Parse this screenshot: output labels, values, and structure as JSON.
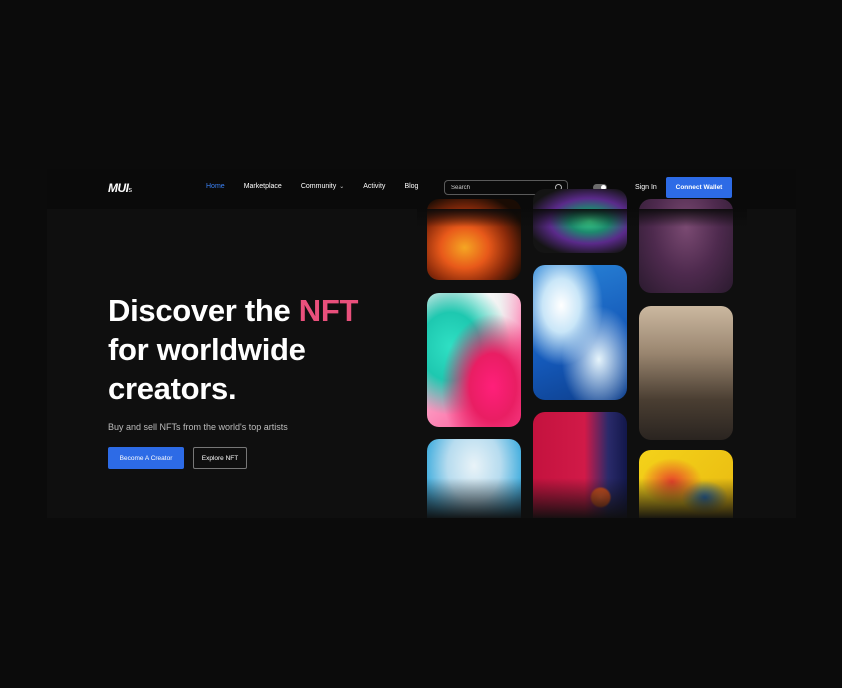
{
  "navbar": {
    "logo": "MUI",
    "logo_suffix": "s",
    "links": [
      {
        "label": "Home",
        "active": true
      },
      {
        "label": "Marketplace",
        "active": false
      },
      {
        "label": "Community",
        "active": false,
        "has_dropdown": true
      },
      {
        "label": "Activity",
        "active": false
      },
      {
        "label": "Blog",
        "active": false
      }
    ],
    "search_placeholder": "Search",
    "theme_toggle": "dark",
    "signin_label": "Sign In",
    "connect_label": "Connect Wallet"
  },
  "hero": {
    "title_part1": "Discover the ",
    "title_accent": "NFT",
    "title_line2": "for worldwide",
    "title_line3": "creators.",
    "subtitle": "Buy and sell NFTs from the world's top artists",
    "primary_button": "Become A Creator",
    "secondary_button": "Explore NFT"
  },
  "colors": {
    "accent_blue": "#2d6be6",
    "accent_pink": "#e9507c",
    "background": "#0f0f0f"
  },
  "gallery": {
    "tiles": [
      {
        "name": "fire-art"
      },
      {
        "name": "pink-teal-fluid-art"
      },
      {
        "name": "icy-white-art"
      },
      {
        "name": "green-swirl-art"
      },
      {
        "name": "blue-ice-art"
      },
      {
        "name": "red-orb-art"
      },
      {
        "name": "purple-abstract-art"
      },
      {
        "name": "misty-forest-art"
      },
      {
        "name": "yellow-paint-art"
      }
    ]
  }
}
